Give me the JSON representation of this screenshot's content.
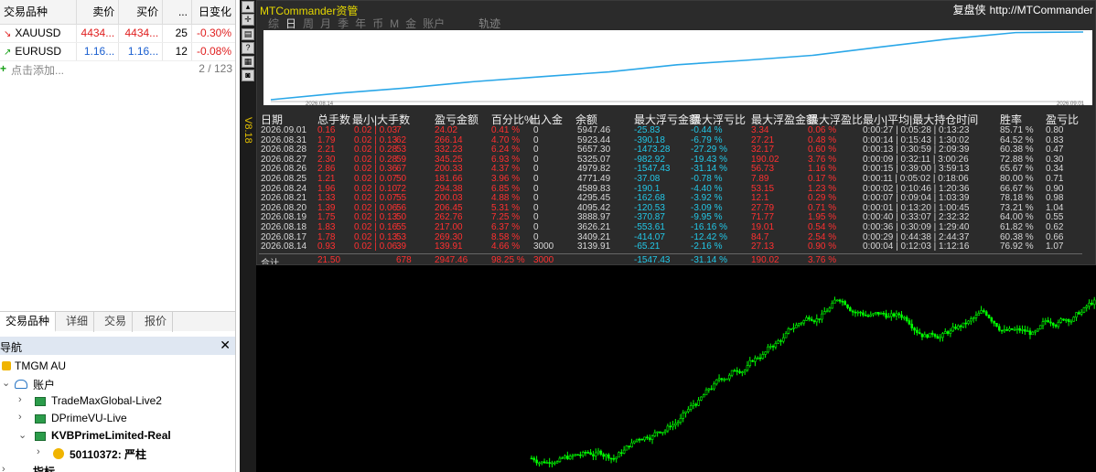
{
  "market_watch": {
    "headers": [
      "交易品种",
      "卖价",
      "买价",
      "...",
      "日变化"
    ],
    "rows": [
      {
        "symbol": "XAUUSD",
        "bid": "4434...",
        "ask": "4434...",
        "spread": "25",
        "change": "-0.30%",
        "dir": "down"
      },
      {
        "symbol": "EURUSD",
        "bid": "1.16...",
        "ask": "1.16...",
        "spread": "12",
        "change": "-0.08%",
        "dir": "up"
      }
    ],
    "add_label": "点击添加...",
    "count": "2 / 123",
    "tabs": [
      "交易品种",
      "详细",
      "交易",
      "报价"
    ]
  },
  "navigator": {
    "title": "导航",
    "close": "✕",
    "broker": "TMGM AU",
    "accounts_label": "账户",
    "servers": [
      "TradeMaxGlobal-Live2",
      "DPrimeVU-Live",
      "KVBPrimeLimited-Real"
    ],
    "account": "50110372: 严柱",
    "indicators_label": "指标"
  },
  "toolbar": {
    "vertical_label": "V8.18"
  },
  "commander": {
    "title": "MTCommander资管",
    "right_label": "复盘侠",
    "url": "http://MTCommander",
    "periods": [
      "综",
      "日",
      "周",
      "月",
      "季",
      "年",
      "币",
      "M",
      "金",
      "账户"
    ],
    "selected_period": "日",
    "track_label": "轨迹",
    "equity": {
      "start_date": "2026.08.14",
      "end_date": "2026.09.01",
      "values": [
        3139.91,
        3409.21,
        3626.21,
        3888.97,
        4095.42,
        4295.45,
        4589.83,
        4771.49,
        4979.82,
        5325.07,
        5657.3,
        5923.44,
        5947.46
      ]
    },
    "columns": [
      "日期",
      "总手数",
      "最小|大手数",
      "盈亏金额",
      "百分比%",
      "出入金",
      "余额",
      "最大浮亏金额",
      "最大浮亏比",
      "最大浮盈金额",
      "最大浮盈比",
      "最小|平均|最大持仓时间",
      "胜率",
      "盈亏比"
    ],
    "rows": [
      [
        "2026.09.01",
        "0.16",
        "0.02 | 0.03",
        "7",
        "24.02",
        "0.41 %",
        "0",
        "5947.46",
        "-25.83",
        "-0.44 %",
        "3.34",
        "0.06 %",
        "0:00:27 | 0:05:28 | 0:13:23",
        "85.71 %",
        "0.80"
      ],
      [
        "2026.08.31",
        "1.79",
        "0.02 | 0.13",
        "62",
        "266.14",
        "4.70 %",
        "0",
        "5923.44",
        "-390.18",
        "-6.79 %",
        "27.21",
        "0.48 %",
        "0:00:14 | 0:15:43 | 1:30:02",
        "64.52 %",
        "0.83"
      ],
      [
        "2026.08.28",
        "2.21",
        "0.02 | 0.28",
        "53",
        "332.23",
        "6.24 %",
        "0",
        "5657.30",
        "-1473.28",
        "-27.29 %",
        "32.17",
        "0.60 %",
        "0:00:13 | 0:30:59 | 2:09:39",
        "60.38 %",
        "0.47"
      ],
      [
        "2026.08.27",
        "2.30",
        "0.02 | 0.28",
        "59",
        "345.25",
        "6.93 %",
        "0",
        "5325.07",
        "-982.92",
        "-19.43 %",
        "190.02",
        "3.76 %",
        "0:00:09 | 0:32:11 | 3:00:26",
        "72.88 %",
        "0.30"
      ],
      [
        "2026.08.26",
        "2.86",
        "0.02 | 0.36",
        "67",
        "200.33",
        "4.37 %",
        "0",
        "4979.82",
        "-1547.43",
        "-31.14 %",
        "56.73",
        "1.16 %",
        "0:00:15 | 0:39:00 | 3:59:13",
        "65.67 %",
        "0.34"
      ],
      [
        "2026.08.25",
        "1.21",
        "0.02 | 0.07",
        "50",
        "181.66",
        "3.96 %",
        "0",
        "4771.49",
        "-37.08",
        "-0.78 %",
        "7.89",
        "0.17 %",
        "0:00:11 | 0:05:02 | 0:18:06",
        "80.00 %",
        "0.71"
      ],
      [
        "2026.08.24",
        "1.96",
        "0.02 | 0.10",
        "72",
        "294.38",
        "6.85 %",
        "0",
        "4589.83",
        "-190.1",
        "-4.40 %",
        "53.15",
        "1.23 %",
        "0:00:02 | 0:10:46 | 1:20:36",
        "66.67 %",
        "0.90"
      ],
      [
        "2026.08.21",
        "1.33",
        "0.02 | 0.07",
        "55",
        "200.03",
        "4.88 %",
        "0",
        "4295.45",
        "-162.68",
        "-3.92 %",
        "12.1",
        "0.29 %",
        "0:00:07 | 0:09:04 | 1:03:39",
        "78.18 %",
        "0.98"
      ],
      [
        "2026.08.20",
        "1.39",
        "0.02 | 0.06",
        "56",
        "206.45",
        "5.31 %",
        "0",
        "4095.42",
        "-120.53",
        "-3.09 %",
        "27.79",
        "0.71 %",
        "0:00:01 | 0:13:20 | 1:00:45",
        "73.21 %",
        "1.04"
      ],
      [
        "2026.08.19",
        "1.75",
        "0.02 | 0.13",
        "50",
        "262.76",
        "7.25 %",
        "0",
        "3888.97",
        "-370.87",
        "-9.95 %",
        "71.77",
        "1.95 %",
        "0:00:40 | 0:33:07 | 2:32:32",
        "64.00 %",
        "0.55"
      ],
      [
        "2026.08.18",
        "1.83",
        "0.02 | 0.16",
        "55",
        "217.00",
        "6.37 %",
        "0",
        "3626.21",
        "-553.61",
        "-16.16 %",
        "19.01",
        "0.54 %",
        "0:00:36 | 0:30:09 | 1:29:40",
        "61.82 %",
        "0.62"
      ],
      [
        "2026.08.17",
        "1.78",
        "0.02 | 0.13",
        "53",
        "269.30",
        "8.58 %",
        "0",
        "3409.21",
        "-414.07",
        "-12.42 %",
        "84.7",
        "2.54 %",
        "0:00:29 | 0:44:38 | 2:44:37",
        "60.38 %",
        "0.66"
      ],
      [
        "2026.08.14",
        "0.93",
        "0.02 | 0.06",
        "39",
        "139.91",
        "4.66 %",
        "3000",
        "3139.91",
        "-65.21",
        "-2.16 %",
        "27.13",
        "0.90 %",
        "0:00:04 | 0:12:03 | 1:12:16",
        "76.92 %",
        "1.07"
      ]
    ],
    "total": [
      "合计",
      "21.50",
      "678",
      "2947.46",
      "98.25 %",
      "3000",
      "-1547.43",
      "-31.14 %",
      "190.02",
      "3.76 %"
    ]
  },
  "price_chart": {
    "candles": [
      [
        0.5,
        0.48,
        0.4,
        0.55
      ],
      [
        0.48,
        0.52,
        0.44,
        0.58
      ],
      [
        0.52,
        0.6,
        0.5,
        0.64
      ],
      [
        0.6,
        0.57,
        0.54,
        0.66
      ],
      [
        0.57,
        0.64,
        0.55,
        0.7
      ],
      [
        0.64,
        0.7,
        0.62,
        0.74
      ],
      [
        0.7,
        0.68,
        0.64,
        0.75
      ],
      [
        0.68,
        0.74,
        0.66,
        0.78
      ],
      [
        0.74,
        0.8,
        0.72,
        0.84
      ],
      [
        0.8,
        0.86,
        0.78,
        0.9
      ],
      [
        0.86,
        0.83,
        0.79,
        0.9
      ],
      [
        0.83,
        0.88,
        0.81,
        0.94
      ],
      [
        0.88,
        0.92,
        0.86,
        0.96
      ],
      [
        0.92,
        0.89,
        0.85,
        0.95
      ],
      [
        0.89,
        0.95,
        0.87,
        0.98
      ],
      [
        0.95,
        0.93,
        0.9,
        1.0
      ]
    ]
  }
}
